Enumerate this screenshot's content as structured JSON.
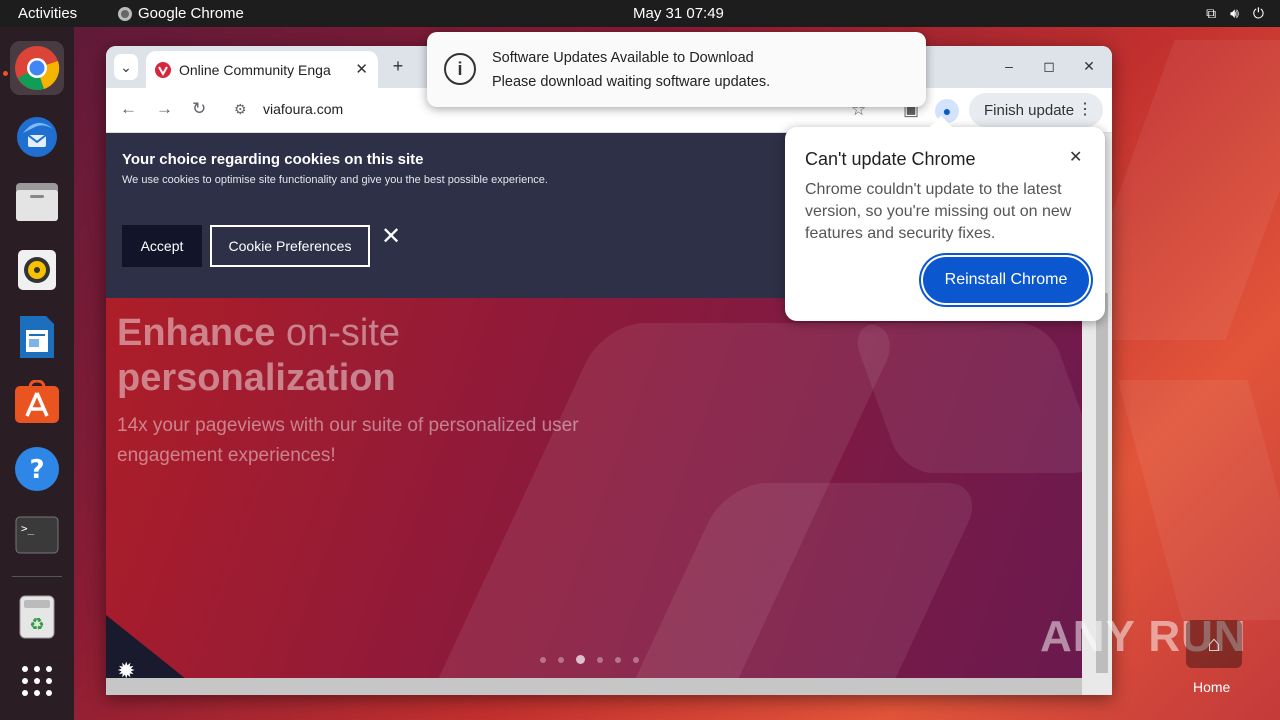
{
  "topbar": {
    "activities": "Activities",
    "app_name": "Google Chrome",
    "clock": "May 31  07:49"
  },
  "dock": {
    "items": [
      "chrome-icon",
      "thunderbird-icon",
      "files-icon",
      "rhythmbox-icon",
      "writer-icon",
      "app-center-icon",
      "help-icon",
      "terminal-icon",
      "trash-icon",
      "apps-grid-icon"
    ]
  },
  "browser": {
    "tab_title": "Online Community Enga",
    "url": "viafoura.com",
    "finish_update": "Finish update"
  },
  "notification": {
    "title": "Software Updates Available to Download",
    "body": "Please download waiting software updates."
  },
  "update_bubble": {
    "title": "Can't update Chrome",
    "body": "Chrome couldn't update to the latest version, so you're missing out on new features and security fixes.",
    "button": "Reinstall Chrome"
  },
  "cookie_banner": {
    "title": "Your choice regarding cookies on this site",
    "text": "We use cookies to optimise site functionality and give you the best possible experience.",
    "accept": "Accept",
    "preferences": "Cookie Preferences"
  },
  "hero": {
    "bold1": "Enhance",
    "light1": "on-site",
    "bold2": "personalization",
    "sub": "14x your pageviews with our suite of personalized user engagement experiences!"
  },
  "carousel": {
    "count": 6,
    "active_index": 2
  },
  "desktop": {
    "watermark": "ANY RUN",
    "home_label": "Home"
  },
  "colors": {
    "accent": "#e95420",
    "chrome_blue": "#0b57d0",
    "cookie_bg": "#2d3047"
  }
}
